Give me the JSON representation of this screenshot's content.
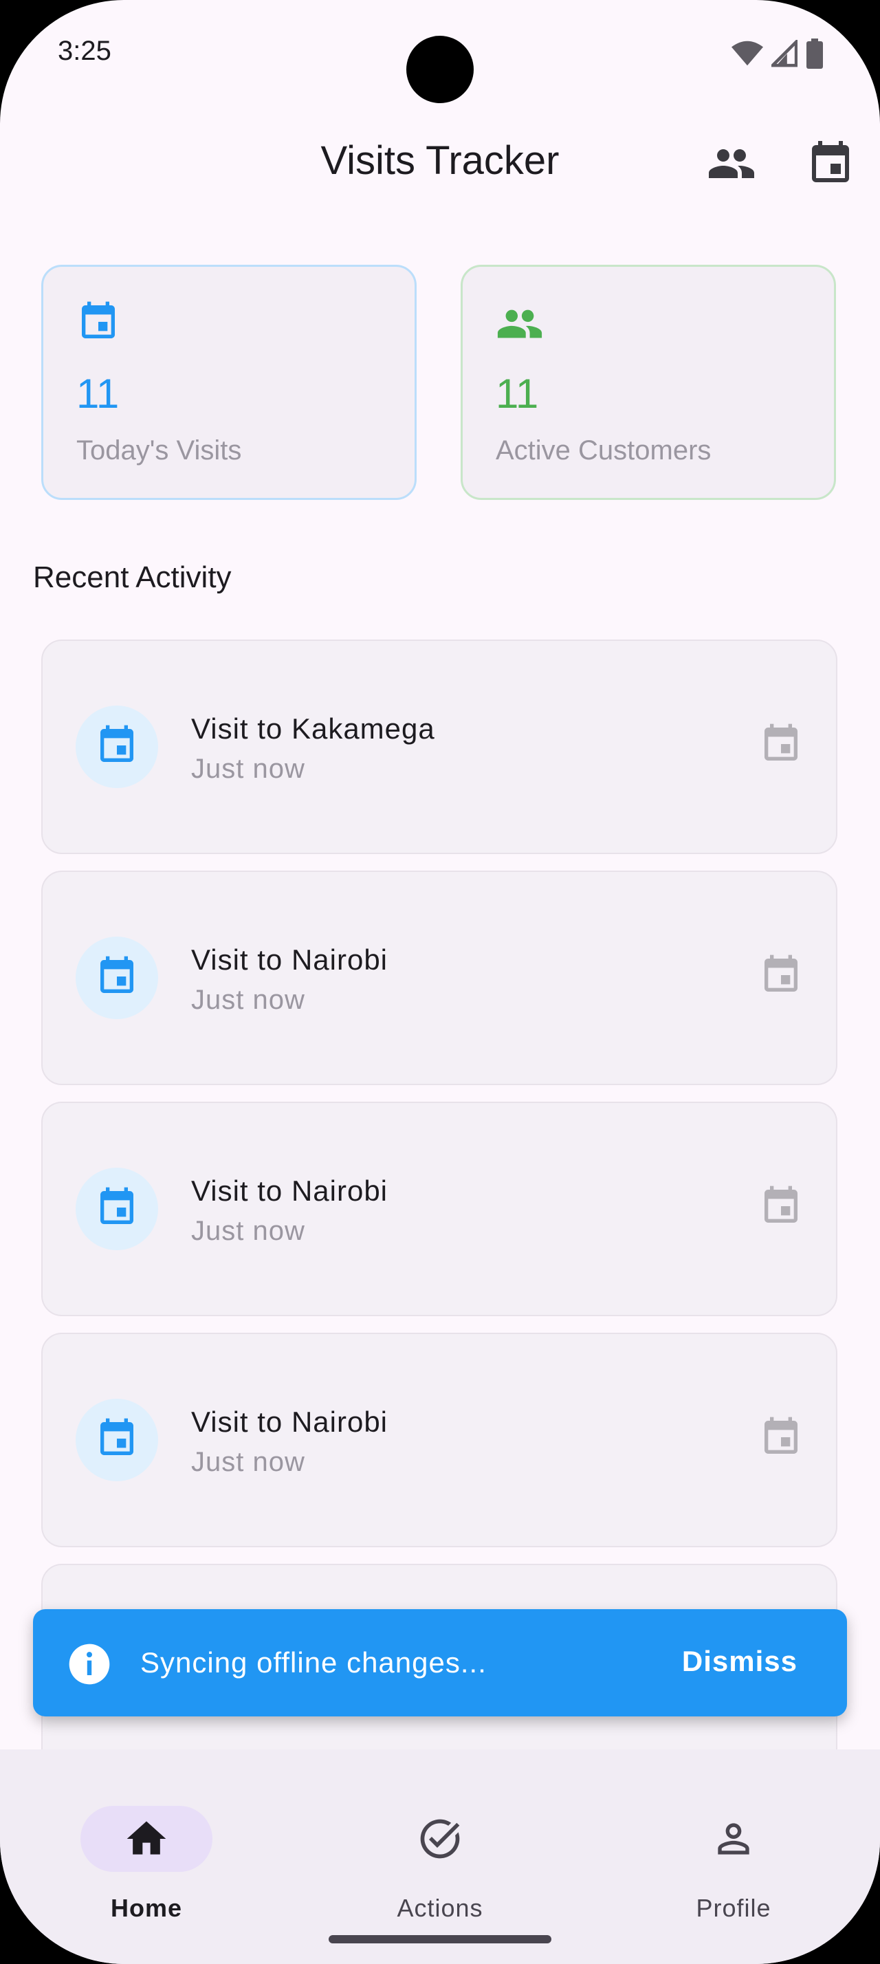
{
  "status_bar": {
    "time": "3:25",
    "icons": [
      "wifi-icon",
      "signal-icon",
      "battery-icon"
    ]
  },
  "app_bar": {
    "title": "Visits Tracker",
    "actions": [
      "customers-icon",
      "calendar-icon"
    ]
  },
  "stats": [
    {
      "value": "11",
      "label": "Today's Visits",
      "icon": "calendar-icon",
      "color": "#2196F3",
      "border": "#BBDEFB"
    },
    {
      "value": "11",
      "label": "Active Customers",
      "icon": "people-icon",
      "color": "#4CAF50",
      "border": "#C8E6C9"
    }
  ],
  "recent_activity": {
    "title": "Recent Activity",
    "items": [
      {
        "title": "Visit to Kakamega",
        "time": "Just now"
      },
      {
        "title": "Visit to Nairobi",
        "time": "Just now"
      },
      {
        "title": "Visit to Nairobi",
        "time": "Just now"
      },
      {
        "title": "Visit to Nairobi",
        "time": "Just now"
      }
    ]
  },
  "snackbar": {
    "message": "Syncing offline changes...",
    "action": "Dismiss",
    "color": "#2196F3"
  },
  "bottom_nav": {
    "items": [
      {
        "label": "Home",
        "icon": "home-icon",
        "selected": true
      },
      {
        "label": "Actions",
        "icon": "check-circle-icon",
        "selected": false
      },
      {
        "label": "Profile",
        "icon": "person-icon",
        "selected": false
      }
    ]
  },
  "colors": {
    "accent": "#2196F3",
    "success": "#4CAF50",
    "background": "#FDF7FD",
    "nav_indicator": "#E8DEF8"
  }
}
